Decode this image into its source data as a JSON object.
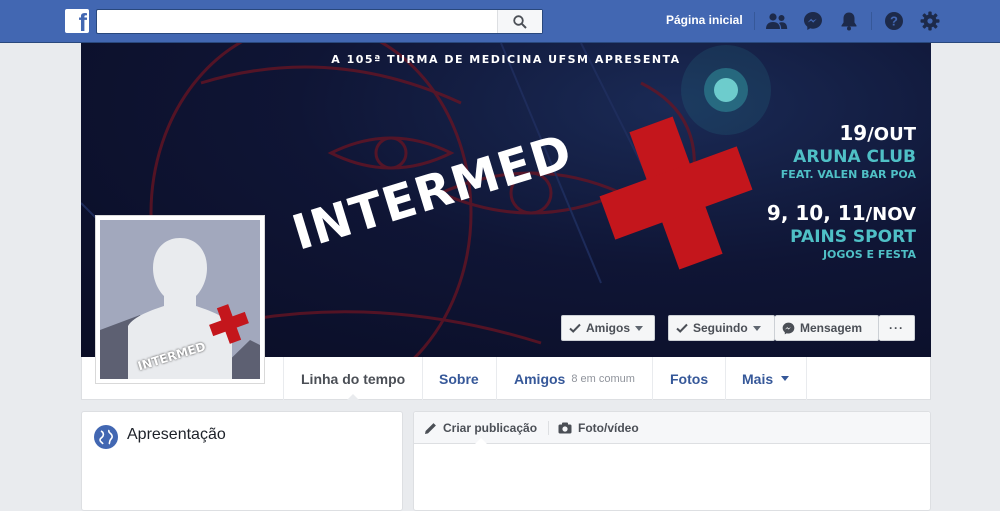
{
  "topbar": {
    "logo_letter": "f",
    "search_placeholder": "",
    "home_label": "Página inicial",
    "icons": [
      "friends-icon",
      "messenger-icon",
      "notifications-icon",
      "help-icon",
      "settings-icon"
    ]
  },
  "cover": {
    "subtitle": "A 105ª TURMA DE MEDICINA UFSM APRESENTA",
    "brand": "INTERMED",
    "events": [
      {
        "date": "19/OUT",
        "date_num": "19",
        "date_rest": "/OUT",
        "place": "ARUNA CLUB",
        "detail": "FEAT. VALEN BAR POA"
      },
      {
        "date": "9, 10, 11/NOV",
        "date_num": "9, 10, 11",
        "date_rest": "/NOV",
        "place": "PAINS SPORT",
        "detail": "JOGOS E FESTA"
      }
    ],
    "colors": {
      "accent_red": "#c4161c",
      "accent_teal": "#4fc0c6",
      "background": "#0f1535"
    }
  },
  "profile": {
    "avatar_brand": "INTERMED"
  },
  "actions": {
    "friends": "Amigos",
    "following": "Seguindo",
    "message": "Mensagem",
    "more": "···"
  },
  "nav": {
    "tabs": [
      {
        "label": "Linha do tempo"
      },
      {
        "label": "Sobre"
      },
      {
        "label": "Amigos",
        "sub": "8 em comum"
      },
      {
        "label": "Fotos"
      },
      {
        "label": "Mais"
      }
    ]
  },
  "intro": {
    "title": "Apresentação"
  },
  "composer": {
    "create_post": "Criar publicação",
    "photo_video": "Foto/vídeo"
  }
}
